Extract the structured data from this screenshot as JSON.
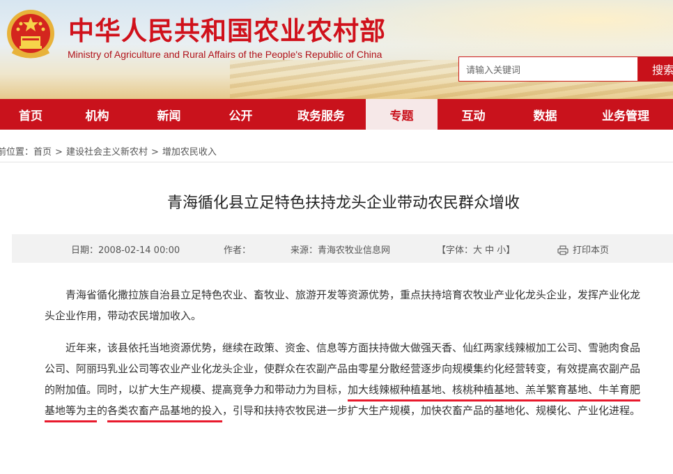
{
  "header": {
    "title": "中华人民共和国农业农村部",
    "subtitle": "Ministry of Agriculture and Rural Affairs of the People's Republic of China",
    "search_placeholder": "请输入关键词",
    "search_button": "搜索"
  },
  "nav": {
    "items": [
      {
        "label": "首页"
      },
      {
        "label": "机构"
      },
      {
        "label": "新闻"
      },
      {
        "label": "公开"
      },
      {
        "label": "政务服务"
      },
      {
        "label": "专题"
      },
      {
        "label": "互动"
      },
      {
        "label": "数据"
      },
      {
        "label": "业务管理"
      }
    ],
    "active_index": 5
  },
  "breadcrumb": {
    "prefix": "前位置：",
    "items": [
      "首页",
      "建设社会主义新农村",
      "增加农民收入"
    ],
    "separator": ">"
  },
  "article": {
    "title": "青海循化县立足特色扶持龙头企业带动农民群众增收",
    "meta": {
      "date": "日期：2008-02-14 00:00",
      "author": "作者：",
      "source": "来源：青海农牧业信息网",
      "font_size": "【字体：大 中 小】",
      "print": "打印本页"
    },
    "paragraph1": "青海省循化撒拉族自治县立足特色农业、畜牧业、旅游开发等资源优势，重点扶持培育农牧业产业化龙头企业，发挥产业化龙头企业作用，带动农民增加收入。",
    "paragraph2": {
      "part1": "近年来，该县依托当地资源优势，继续在政策、资金、信息等方面扶持做大做强天香、仙红两家线辣椒加工公司、雪驰肉食品公司、阿丽玛乳业公司等农业产业化龙头企业，使群众在农副产品由零星分散经营逐步向规模集约化经营转变，有效提高农副产品的附加值。同时，以扩大生产规模、提高竞争力和带动力为目标，",
      "highlight1": "加大线辣椒种植基地、核桃种植基地、羔羊繁育基地、牛羊育肥基地等为主",
      "highlight2": "的",
      "highlight3": "各类农畜产品基地的投入",
      "part2": "，引导和扶持农牧民进一步扩大生产规模，加快农畜产品的基地化、规模化、产业化进程。"
    }
  },
  "colors": {
    "brand_red": "#c9121c",
    "title_red": "#d0111b",
    "underline_red": "#e8192c"
  }
}
